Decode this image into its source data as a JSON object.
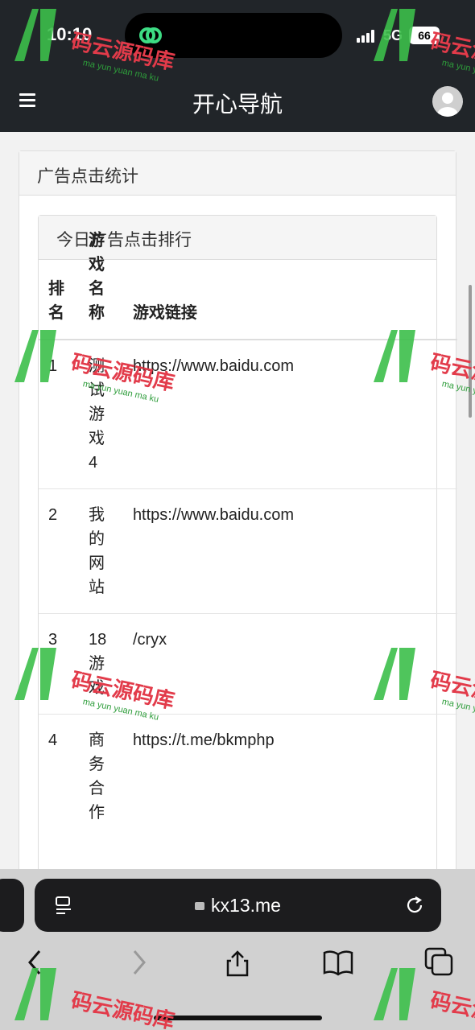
{
  "status_bar": {
    "time": "10:10",
    "network": "5G",
    "battery": "66"
  },
  "header": {
    "title": "开心导航"
  },
  "outer_card": {
    "title": "广告点击统计"
  },
  "inner_card": {
    "title": "今日广告点击排行"
  },
  "table": {
    "headers": [
      "排名",
      "游戏名称",
      "游戏链接"
    ],
    "rows": [
      {
        "rank": "1",
        "name": "测试游戏4",
        "link": "https://www.baidu.com"
      },
      {
        "rank": "2",
        "name": "我的网站",
        "link": "https://www.baidu.com"
      },
      {
        "rank": "3",
        "name": "18游戏",
        "link": "/cryx"
      },
      {
        "rank": "4",
        "name": "商务合作",
        "link": "https://t.me/bkmphp"
      }
    ]
  },
  "browser": {
    "url": "kx13.me"
  },
  "watermark": {
    "text": "码云源码库",
    "sub": "ma yun yuan ma ku"
  },
  "colors": {
    "header_bg": "#212529",
    "page_bg": "#f2f2f2",
    "watermark_red": "#e23b4a",
    "watermark_green": "#2e9d3b"
  }
}
